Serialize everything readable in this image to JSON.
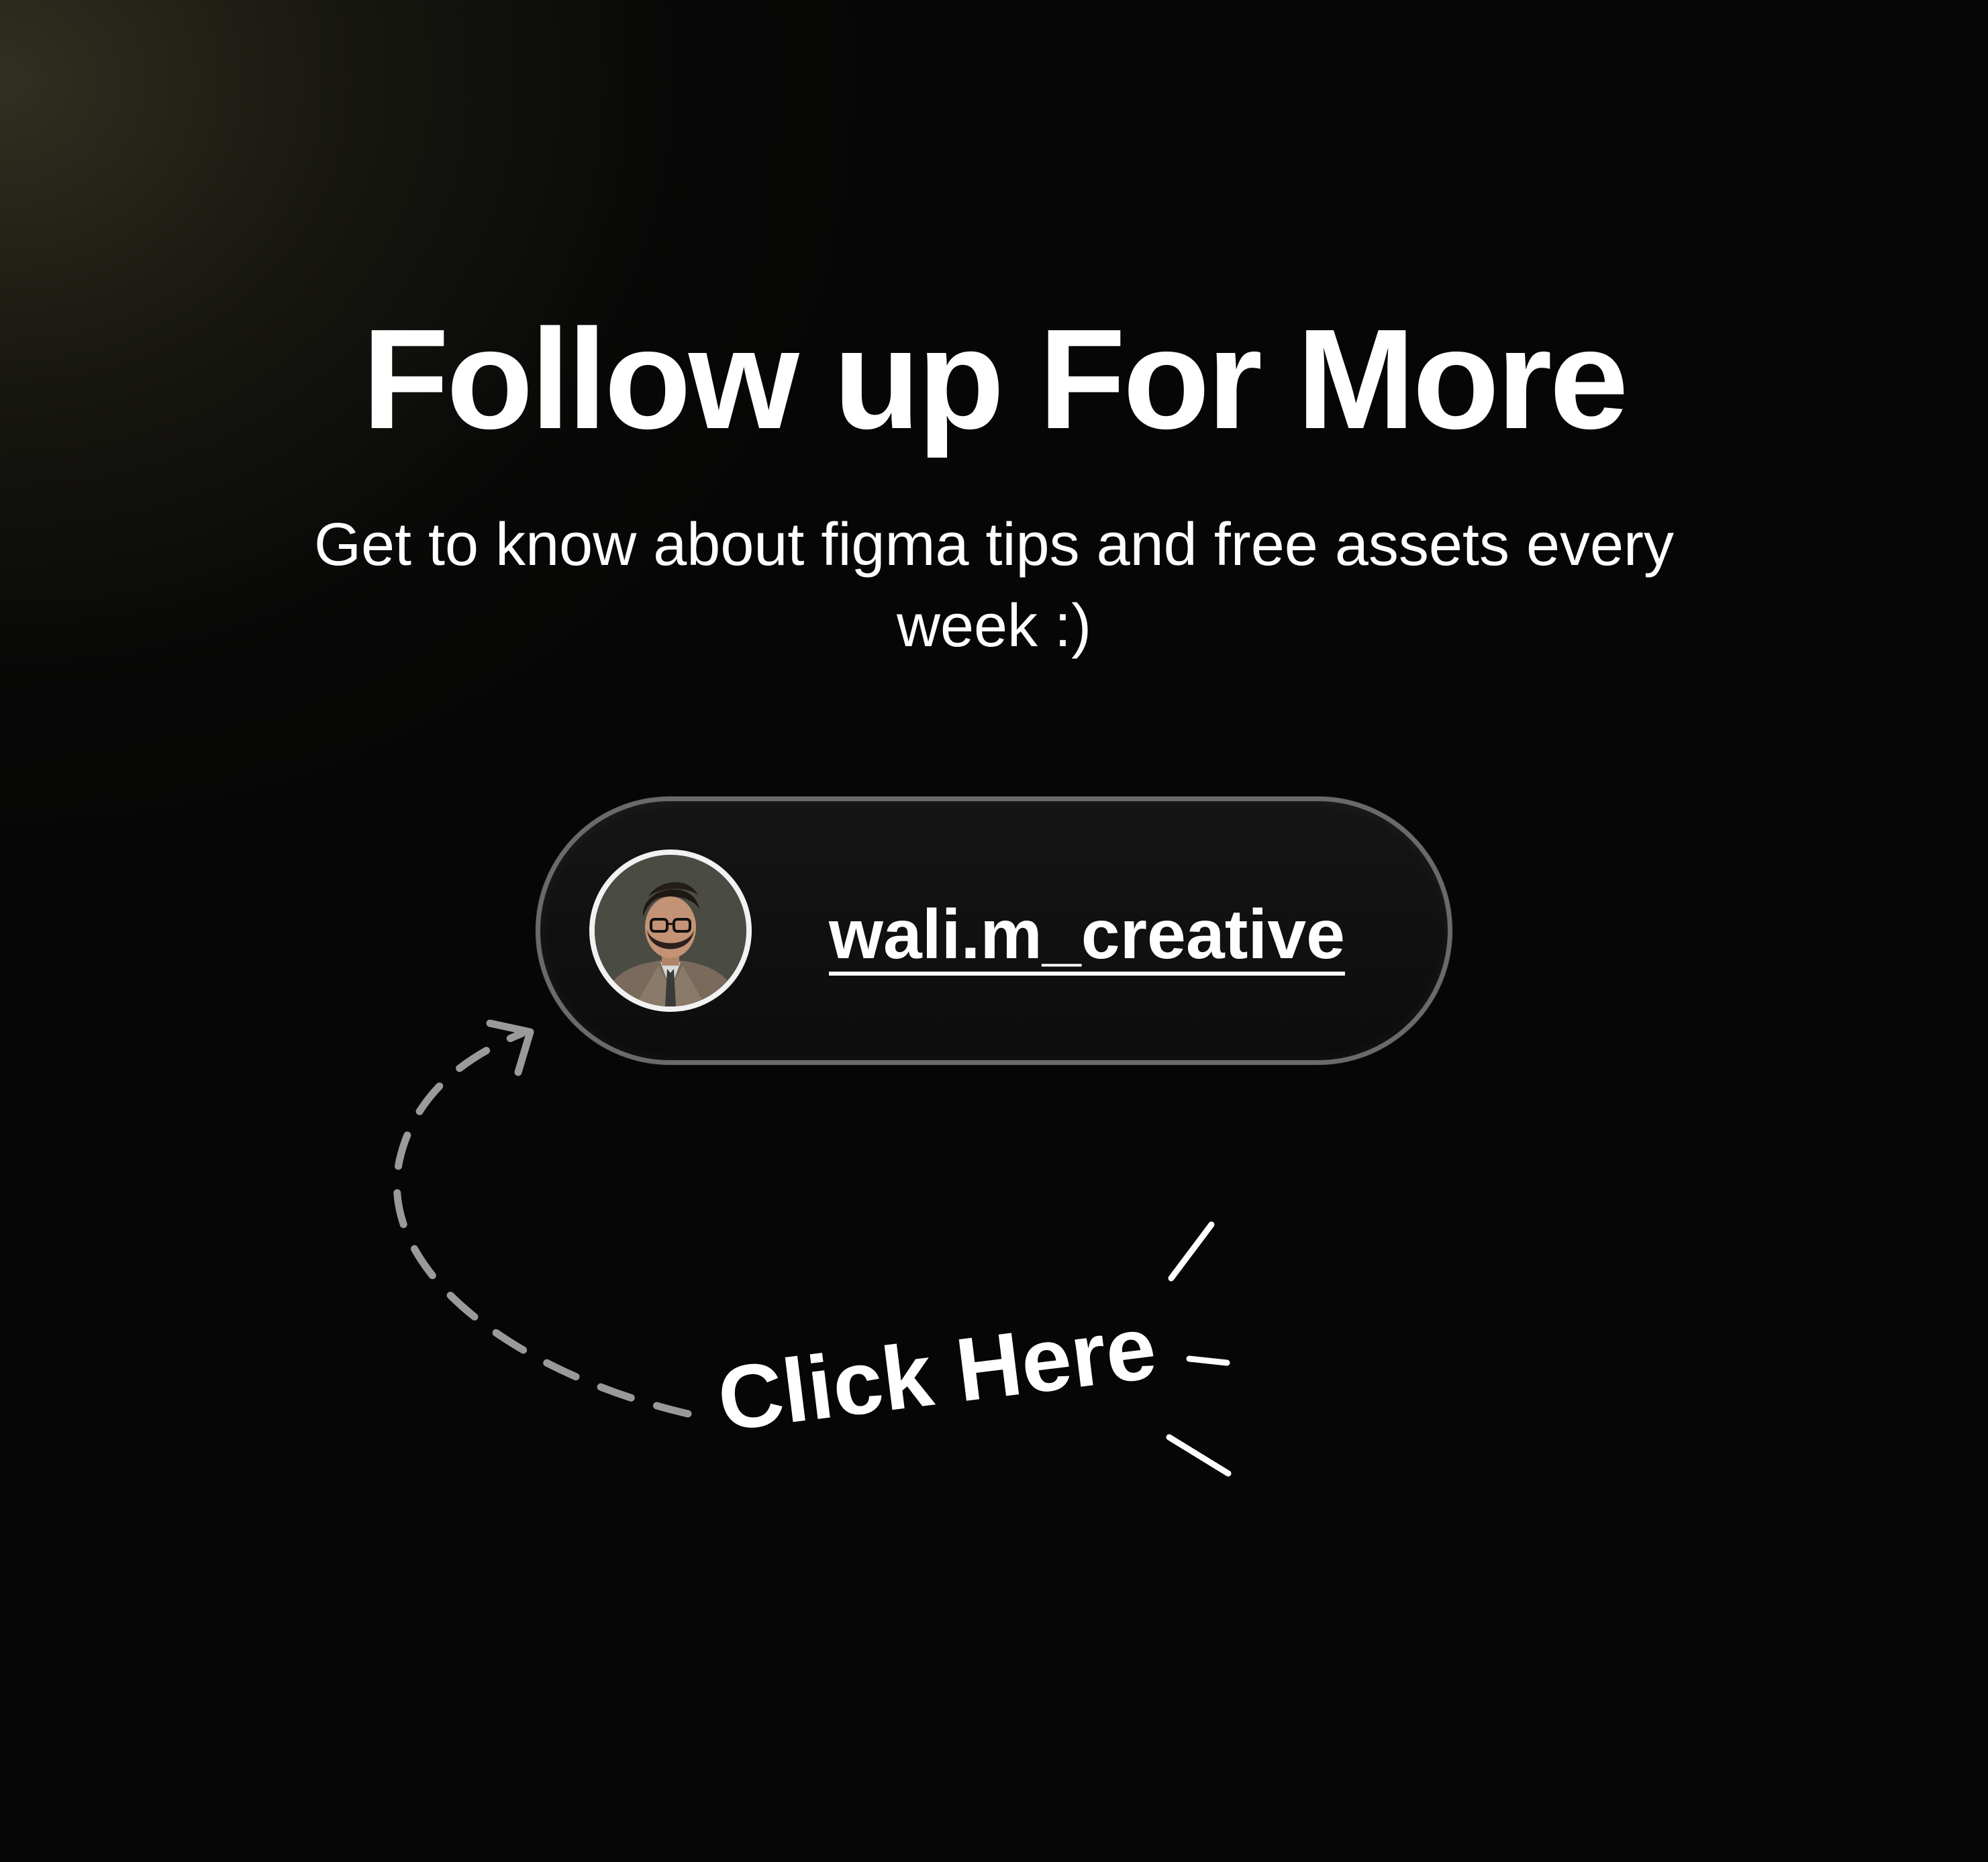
{
  "title": "Follow up For More",
  "subtitle": "Get to know about figma tips and free assets every week :)",
  "profile": {
    "username": "wali.m_creative",
    "avatar_icon": "profile-photo"
  },
  "cta": {
    "label": "Click Here"
  },
  "colors": {
    "background": "#050505",
    "text": "#ffffff",
    "pill_border": "#6a6a6a",
    "arrow": "#9a9a9a"
  }
}
